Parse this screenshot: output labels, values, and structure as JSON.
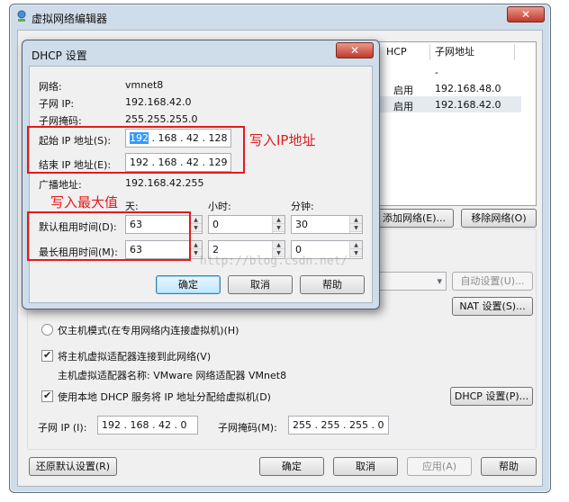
{
  "outer": {
    "title": "虚拟网络编辑器",
    "close": "✕",
    "table": {
      "headers": [
        "HCP",
        "子网地址"
      ],
      "rows": [
        {
          "dhcp": "",
          "subnet": "-"
        },
        {
          "dhcp": "启用",
          "subnet": "192.168.48.0"
        },
        {
          "dhcp": "启用",
          "subnet": "192.168.42.0"
        }
      ]
    },
    "add_network": "添加网络(E)...",
    "remove_network": "移除网络(O)",
    "auto_settings": "自动设置(U)...",
    "nat_settings": "NAT 设置(S)...",
    "host_only": "仅主机模式(在专用网络内连接虚拟机)(H)",
    "connect_adapter": "将主机虚拟适配器连接到此网络(V)",
    "adapter_name_label": "主机虚拟适配器名称: VMware 网络适配器 VMnet8",
    "use_dhcp": "使用本地 DHCP 服务将 IP 地址分配给虚拟机(D)",
    "dhcp_settings": "DHCP 设置(P)...",
    "subnet_ip_label": "子网 IP (I):",
    "subnet_ip": "192 . 168 . 42 .  0",
    "subnet_mask_label": "子网掩码(M):",
    "subnet_mask": "255 . 255 . 255 .  0",
    "restore_defaults": "还原默认设置(R)",
    "ok": "确定",
    "cancel": "取消",
    "apply": "应用(A)",
    "help": "帮助"
  },
  "dhcp": {
    "title": "DHCP 设置",
    "close": "✕",
    "network_label": "网络:",
    "network_value": "vmnet8",
    "subnet_ip_label": "子网 IP:",
    "subnet_ip_value": "192.168.42.0",
    "subnet_mask_label": "子网掩码:",
    "subnet_mask_value": "255.255.255.0",
    "start_ip_label": "起始 IP 地址(S):",
    "start_ip_first": "192",
    "start_ip_rest": " . 168 . 42 . 128",
    "end_ip_label": "结束 IP 地址(E):",
    "end_ip": "192 . 168 . 42 . 129",
    "broadcast_label": "广播地址:",
    "broadcast_value": "192.168.42.255",
    "days_label": "天:",
    "hours_label": "小时:",
    "minutes_label": "分钟:",
    "default_lease_label": "默认租用时间(D):",
    "default_days": "63",
    "default_hours": "0",
    "default_minutes": "30",
    "max_lease_label": "最长租用时间(M):",
    "max_days": "63",
    "max_hours": "2",
    "max_minutes": "0",
    "ok": "确定",
    "cancel": "取消",
    "help": "帮助"
  },
  "annotations": {
    "write_ip": "写入IP地址",
    "write_max": "写入最大值"
  },
  "watermark": "http://blog.csdn.net/",
  "colors": {
    "annotation": "#e31b1b",
    "title_bar": "#cfdcea",
    "close_button": "#c0392b"
  }
}
